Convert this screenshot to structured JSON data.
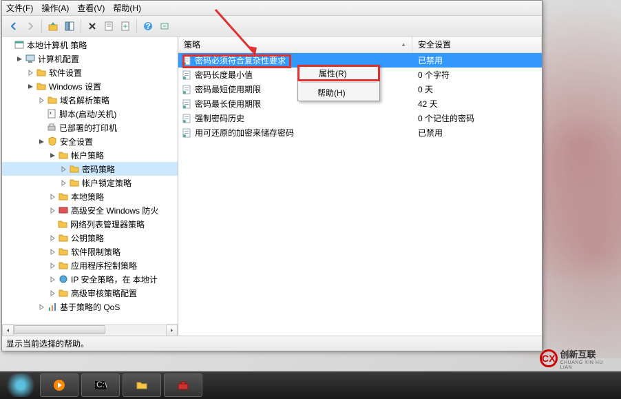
{
  "menubar": {
    "file": "文件(F)",
    "action": "操作(A)",
    "view": "查看(V)",
    "help": "帮助(H)"
  },
  "tree": {
    "root": "本地计算机 策略",
    "computer_config": "计算机配置",
    "software_settings": "软件设置",
    "windows_settings": "Windows 设置",
    "dns_policy": "域名解析策略",
    "scripts": "脚本(启动/关机)",
    "deployed_printers": "已部署的打印机",
    "security_settings": "安全设置",
    "account_policy": "帐户策略",
    "password_policy": "密码策略",
    "lockout_policy": "帐户锁定策略",
    "local_policy": "本地策略",
    "wfas": "高级安全 Windows 防火",
    "nlm": "网络列表管理器策略",
    "public_key": "公钥策略",
    "software_restrict": "软件限制策略",
    "app_control": "应用程序控制策略",
    "ipsec": "IP 安全策略，在 本地计",
    "audit": "高级审核策略配置",
    "qos": "基于策略的 QoS"
  },
  "list": {
    "col_policy": "策略",
    "col_setting": "安全设置",
    "rows": [
      {
        "name": "密码必须符合复杂性要求",
        "value": "已禁用",
        "selected": true
      },
      {
        "name": "密码长度最小值",
        "value": "0 个字符",
        "selected": false
      },
      {
        "name": "密码最短使用期限",
        "value": "0 天",
        "selected": false
      },
      {
        "name": "密码最长使用期限",
        "value": "42 天",
        "selected": false
      },
      {
        "name": "强制密码历史",
        "value": "0 个记住的密码",
        "selected": false
      },
      {
        "name": "用可还原的加密来储存密码",
        "value": "已禁用",
        "selected": false
      }
    ]
  },
  "context_menu": {
    "properties": "属性(R)",
    "help": "帮助(H)"
  },
  "statusbar": {
    "text": "显示当前选择的帮助。"
  },
  "logo": {
    "text": "创新互联",
    "sub": "CHUANG XIN HU LIAN"
  }
}
